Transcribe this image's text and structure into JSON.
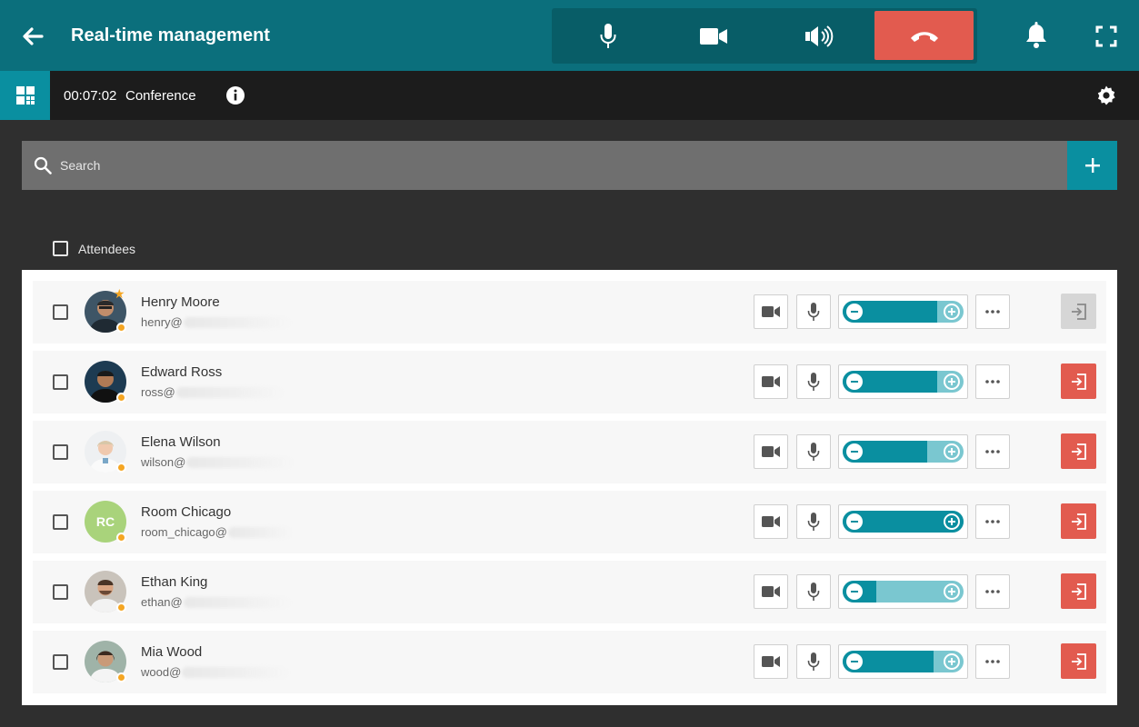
{
  "header": {
    "title": "Real-time management",
    "colors": {
      "header_bg": "#0b6f7c",
      "hangup": "#e25b4f",
      "accent": "#0a8fa0"
    },
    "icons": [
      "back-arrow-icon",
      "microphone-icon",
      "camera-icon",
      "speaker-icon",
      "hang-up-icon",
      "bell-icon",
      "fullscreen-icon"
    ]
  },
  "subbar": {
    "timer": "00:07:02",
    "label": "Conference",
    "icons": [
      "grid-icon",
      "info-icon",
      "gear-icon"
    ]
  },
  "search": {
    "placeholder": "Search",
    "value": ""
  },
  "list": {
    "header_label": "Attendees",
    "attendees": [
      {
        "name": "Henry Moore",
        "email_prefix": "henry@",
        "host": true,
        "volume_fraction": 0.78,
        "exit_enabled": false,
        "status": "online",
        "avatar": "photo"
      },
      {
        "name": "Edward Ross",
        "email_prefix": "ross@",
        "host": false,
        "volume_fraction": 0.78,
        "exit_enabled": true,
        "status": "online",
        "avatar": "photo"
      },
      {
        "name": "Elena Wilson",
        "email_prefix": "wilson@",
        "host": false,
        "volume_fraction": 0.7,
        "exit_enabled": true,
        "status": "online",
        "avatar": "photo"
      },
      {
        "name": "Room Chicago",
        "email_prefix": "room_chicago@",
        "host": false,
        "volume_fraction": 1.0,
        "exit_enabled": true,
        "status": "online",
        "avatar": "RC"
      },
      {
        "name": "Ethan King",
        "email_prefix": "ethan@",
        "host": false,
        "volume_fraction": 0.28,
        "exit_enabled": true,
        "status": "online",
        "avatar": "photo"
      },
      {
        "name": "Mia Wood",
        "email_prefix": "wood@",
        "host": false,
        "volume_fraction": 0.75,
        "exit_enabled": true,
        "status": "online",
        "avatar": "photo"
      }
    ]
  }
}
